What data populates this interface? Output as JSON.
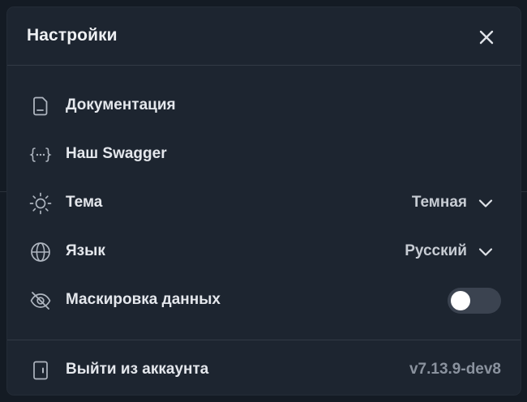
{
  "modal": {
    "title": "Настройки"
  },
  "menu": {
    "documentation_label": "Документация",
    "swagger_label": "Наш Swagger",
    "theme_label": "Тема",
    "theme_value": "Темная",
    "language_label": "Язык",
    "language_value": "Русский",
    "masking_label": "Маскировка данных",
    "masking_enabled": false
  },
  "footer": {
    "logout_label": "Выйти из аккаунта",
    "version": "v7.13.9-dev8"
  },
  "icons": {
    "close": "close-icon",
    "documentation": "document-icon",
    "swagger": "code-braces-icon",
    "theme": "sun-icon",
    "language": "globe-icon",
    "masking": "eye-off-icon",
    "logout": "door-exit-icon",
    "dropdown": "chevron-down-icon"
  },
  "colors": {
    "modal_background": "#1d2530",
    "text_primary": "#e4e7ec",
    "text_muted": "#8a929e",
    "toggle_off": "#3b4350"
  }
}
